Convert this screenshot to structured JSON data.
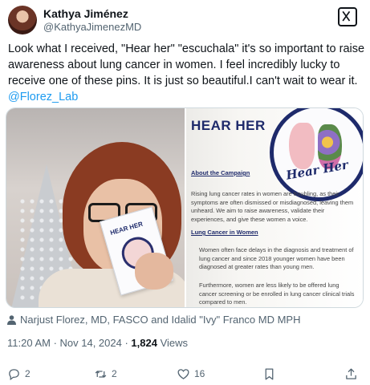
{
  "tweet": {
    "author_name": "Kathya Jiménez",
    "author_handle": "@KathyaJimenezMD",
    "text": "Look what I received, \"Hear her\" \"escuchala\" it's so important to raise awareness about lung cancer in women. I feel incredibly lucky to receive one of these pins. It is just so beautiful.I can't wait to wear it.",
    "mention": "@Florez_Lab"
  },
  "media": {
    "photo2": {
      "heading": "HEAR HER",
      "badge_text": "Hear Her",
      "section1": "About the Campaign",
      "section1_text": "Rising lung cancer rates in women are troubling, as their symptoms are often dismissed or misdiagnosed, leaving them unheard. We aim to raise awareness, validate their experiences, and give these women a voice.",
      "section2": "Lung Cancer in Women",
      "bullet1": "Women often face delays in the diagnosis and treatment of lung cancer and since 2018 younger women have been diagnosed at greater rates than young men.",
      "bullet2": "Furthermore, women are less likely to be offered lung cancer screening or be enrolled in lung cancer clinical trials compared to men."
    },
    "photo1": {
      "card_text": "HEAR HER"
    }
  },
  "tagged": "Narjust Florez, MD, FASCO and Idalid \"Ivy\" Franco MD MPH",
  "meta": {
    "time_date": "11:20 AM · Nov 14, 2024 · ",
    "views_count": "1,824",
    "views_label": " Views"
  },
  "actions": {
    "replies": "2",
    "retweets": "2",
    "likes": "16"
  },
  "icons": [
    "x-logo-icon",
    "person-icon",
    "reply-icon",
    "retweet-icon",
    "like-icon",
    "bookmark-icon",
    "share-icon"
  ],
  "colors": {
    "link": "#1d9bf0",
    "muted": "#536471",
    "text": "#0f1419",
    "campaign_navy": "#1e2a6b"
  }
}
